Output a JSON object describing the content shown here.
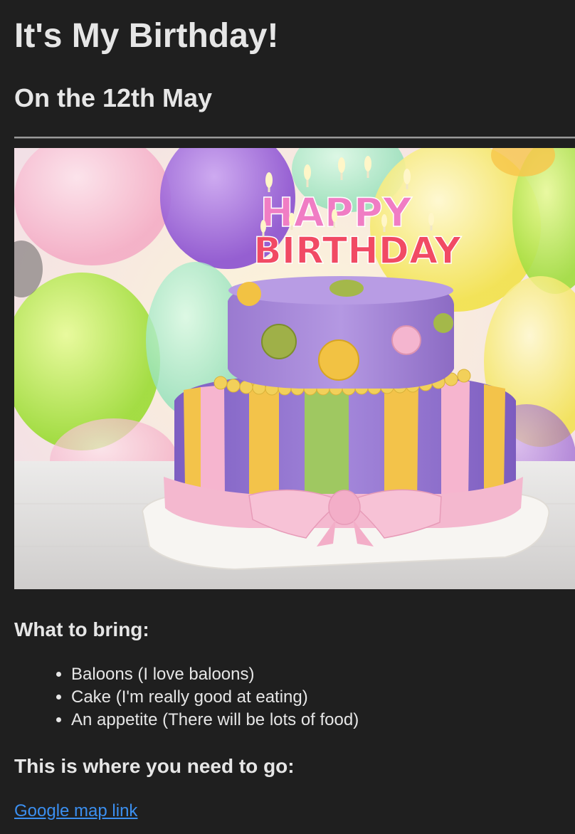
{
  "page": {
    "title": "It's My Birthday!",
    "subtitle": "On the 12th May"
  },
  "hero_image": {
    "alt": "Birthday cake",
    "candle_text_top": "HAPPY",
    "candle_text_bottom": "BIRTHDAY"
  },
  "bring": {
    "heading": "What to bring:",
    "items": [
      "Baloons (I love baloons)",
      "Cake (I'm really good at eating)",
      "An appetite (There will be lots of food)"
    ]
  },
  "location": {
    "heading": "This is where you need to go:",
    "link_text": "Google map link"
  },
  "colors": {
    "background": "#1f1f1f",
    "text": "#e6e6e6",
    "link": "#3b8ff0"
  }
}
